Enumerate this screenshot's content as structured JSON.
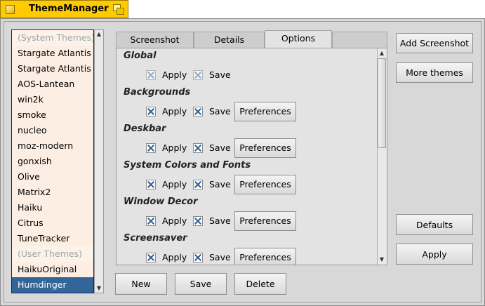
{
  "window": {
    "title": "ThemeManager"
  },
  "theme_list": {
    "items": [
      {
        "label": "(System Themes)",
        "kind": "header"
      },
      {
        "label": "Stargate Atlantis Ancient",
        "kind": "item"
      },
      {
        "label": "Stargate Atlantis",
        "kind": "item"
      },
      {
        "label": "AOS-Lantean",
        "kind": "item"
      },
      {
        "label": "win2k",
        "kind": "item"
      },
      {
        "label": "smoke",
        "kind": "item"
      },
      {
        "label": "nucleo",
        "kind": "item"
      },
      {
        "label": "moz-modern",
        "kind": "item"
      },
      {
        "label": "gonxish",
        "kind": "item"
      },
      {
        "label": "Olive",
        "kind": "item"
      },
      {
        "label": "Matrix2",
        "kind": "item"
      },
      {
        "label": "Haiku",
        "kind": "item"
      },
      {
        "label": "Citrus",
        "kind": "item"
      },
      {
        "label": "TuneTracker",
        "kind": "item"
      },
      {
        "label": "(User Themes)",
        "kind": "header"
      },
      {
        "label": "HaikuOriginal",
        "kind": "item"
      },
      {
        "label": "Humdinger",
        "kind": "selected"
      }
    ]
  },
  "tabs": [
    {
      "label": "Screenshot",
      "active": false
    },
    {
      "label": "Details",
      "active": false
    },
    {
      "label": "Options",
      "active": true
    }
  ],
  "options": {
    "apply_label": "Apply",
    "save_label": "Save",
    "preferences_label": "Preferences",
    "sections": [
      {
        "title": "Global",
        "apply": true,
        "save": true,
        "disabled": true,
        "has_preferences": false
      },
      {
        "title": "Backgrounds",
        "apply": true,
        "save": true,
        "disabled": false,
        "has_preferences": true
      },
      {
        "title": "Deskbar",
        "apply": true,
        "save": true,
        "disabled": false,
        "has_preferences": true
      },
      {
        "title": "System Colors and Fonts",
        "apply": true,
        "save": true,
        "disabled": false,
        "has_preferences": true
      },
      {
        "title": "Window Decor",
        "apply": true,
        "save": true,
        "disabled": false,
        "has_preferences": true
      },
      {
        "title": "Screensaver",
        "apply": true,
        "save": true,
        "disabled": false,
        "has_preferences": true
      }
    ]
  },
  "buttons": {
    "add_screenshot": "Add Screenshot",
    "more_themes": "More themes",
    "defaults": "Defaults",
    "apply": "Apply",
    "new": "New",
    "save": "Save",
    "delete": "Delete"
  },
  "colors": {
    "title_tab": "#ffcb00",
    "selection": "#336698",
    "check": "#2e5f96"
  }
}
